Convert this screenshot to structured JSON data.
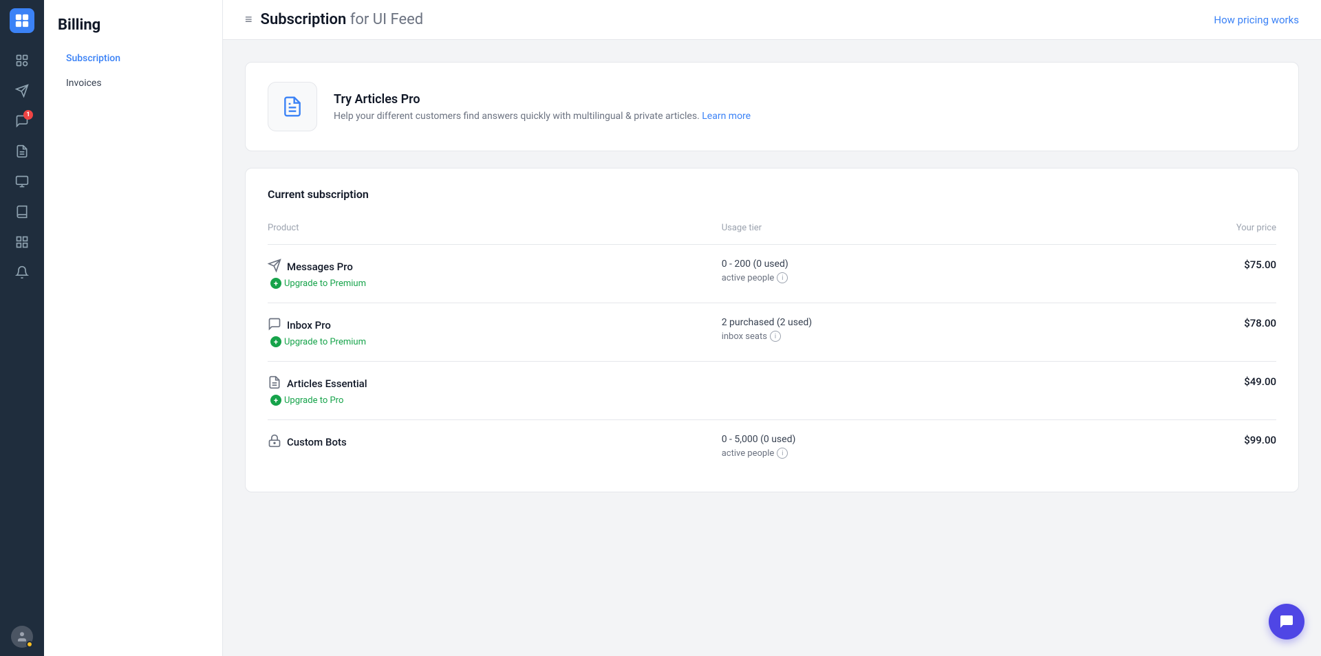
{
  "rail": {
    "logo_icon": "⊞",
    "icons": [
      {
        "name": "contacts-icon",
        "glyph": "👤",
        "badge": null
      },
      {
        "name": "messages-icon",
        "glyph": "✈",
        "badge": null
      },
      {
        "name": "inbox-icon",
        "glyph": "💬",
        "badge": "1"
      },
      {
        "name": "reports-icon",
        "glyph": "📋",
        "badge": null
      },
      {
        "name": "outbound-icon",
        "glyph": "📤",
        "badge": null
      },
      {
        "name": "knowledge-icon",
        "glyph": "📑",
        "badge": null
      },
      {
        "name": "apps-icon",
        "glyph": "⊞",
        "badge": null
      },
      {
        "name": "notifications-icon",
        "glyph": "🔔",
        "badge": null
      }
    ]
  },
  "sidebar": {
    "title": "Billing",
    "nav": [
      {
        "label": "Subscription",
        "active": true
      },
      {
        "label": "Invoices",
        "active": false
      }
    ]
  },
  "header": {
    "title_prefix": "Subscription",
    "title_suffix": "for UI Feed",
    "hamburger_label": "≡",
    "how_pricing_label": "How pricing works"
  },
  "promo": {
    "title": "Try Articles Pro",
    "description": "Help your different customers find answers quickly with multilingual & private articles.",
    "learn_more_label": "Learn more"
  },
  "subscription": {
    "section_title": "Current subscription",
    "table": {
      "headers": [
        "Product",
        "Usage tier",
        "Your price"
      ],
      "rows": [
        {
          "product_name": "Messages Pro",
          "product_icon": "✈",
          "upgrade_label": "Upgrade to Premium",
          "usage_tier": "0 - 200 (0 used)",
          "usage_sub": "active people",
          "price": "$75.00"
        },
        {
          "product_name": "Inbox Pro",
          "product_icon": "💬",
          "upgrade_label": "Upgrade to Premium",
          "usage_tier": "2 purchased (2 used)",
          "usage_sub": "inbox seats",
          "price": "$78.00"
        },
        {
          "product_name": "Articles Essential",
          "product_icon": "📑",
          "upgrade_label": "Upgrade to Pro",
          "usage_tier": "",
          "usage_sub": "",
          "price": "$49.00"
        },
        {
          "product_name": "Custom Bots",
          "product_icon": "🤖",
          "upgrade_label": "",
          "usage_tier": "0 - 5,000 (0 used)",
          "usage_sub": "active people",
          "price": "$99.00"
        }
      ]
    }
  },
  "chat_bubble": {
    "icon": "💬"
  }
}
